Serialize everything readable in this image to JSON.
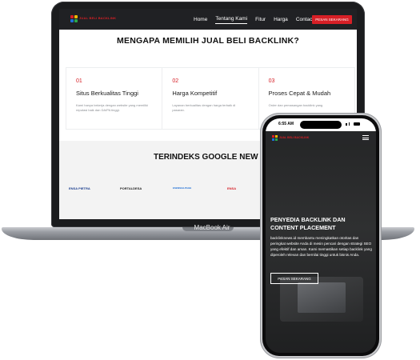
{
  "laptop": {
    "model_label": "MacBook Air",
    "site": {
      "logo_text": "JUAL BELI BACKLINK",
      "nav": {
        "links": [
          "Home",
          "Tentang Kami",
          "Fitur",
          "Harga",
          "Contact"
        ],
        "active": "Tentang Kami",
        "cta": "PESAN SEKARANG"
      },
      "why_heading": "MENGAPA MEMILIH JUAL BELI BACKLINK?",
      "cards": [
        {
          "number": "01",
          "title": "Situs Berkualitas Tinggi",
          "text": "Kami hanya bekerja dengan website yang memiliki reputasi baik dan DA/PA tinggi."
        },
        {
          "number": "02",
          "title": "Harga Kompetitif",
          "text": "Layanan berkualitas dengan harga terbaik di pasaran."
        },
        {
          "number": "03",
          "title": "Proses Cepat & Mudah",
          "text": "Order dan pemasangan backlink yang"
        }
      ],
      "indexed_heading": "TERINDEKS GOOGLE NEW",
      "partners": [
        "ENSA PIETRA",
        "PORTALDESA",
        "ESENSIALPAGE",
        "ENSA"
      ]
    }
  },
  "phone": {
    "status_time": "6:55 AM",
    "logo_text": "JUAL BELI BACKLINK",
    "hero": {
      "title": "PENYEDIA BACKLINK DAN CONTENT PLACEMENT",
      "text": "backlinknews.id membantu meningkatkan otoritas dan peringkat website Anda di mesin pencari dengan strategi SEO yang efektif dan aman. Kami memastikan setiap backlink yang diperoleh relevan dan bernilai tinggi untuk bisnis Anda.",
      "button": "PESAN SEKARANG"
    }
  },
  "colors": {
    "accent": "#d61f26",
    "nav_bg": "#202124",
    "hero_bg": "#2a2b2c"
  }
}
